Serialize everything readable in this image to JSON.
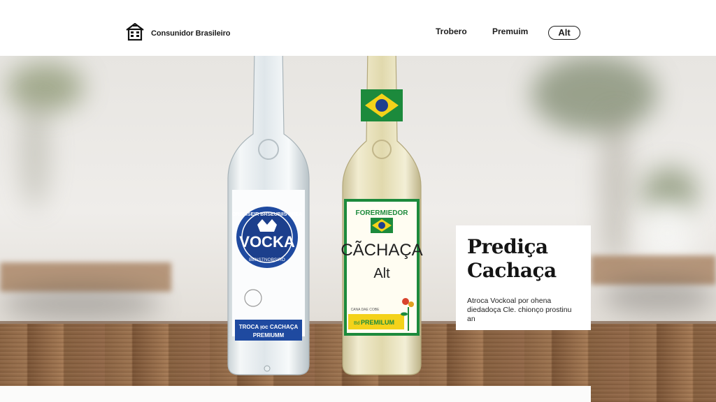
{
  "header": {
    "brand_name": "Consunidor Brasileiro",
    "nav": [
      "Trobero",
      "Premuim"
    ],
    "alt_button": "Alt"
  },
  "bottles": {
    "vodka": {
      "label_top_arc": "ORBEISEIR BRSEUBIIS BREA",
      "brand": "VOCKA",
      "label_bottom_arc": "BENSTNOBSIRO",
      "band_line1": "TROCA ᴉᴏᴄ CACHAÇA",
      "band_line2": "PREMIUMM"
    },
    "cachaca": {
      "label_top": "FORERMIEDOR",
      "brand": "CÃCHAÇA",
      "subtitle": "Alt",
      "small_text": "CANA DAE COBE",
      "band_text": "PREMILUM",
      "band_mark": "Bd"
    }
  },
  "promo": {
    "title_line1": "Prediça",
    "title_line2": "Cachaça",
    "text": "Atroca Vockoal por ohena diedadoça Cle. chionço prostinu an"
  },
  "colors": {
    "accent_navy": "#1f4aa0",
    "accent_green": "#1c8a3c",
    "accent_yellow": "#f4d21a"
  }
}
